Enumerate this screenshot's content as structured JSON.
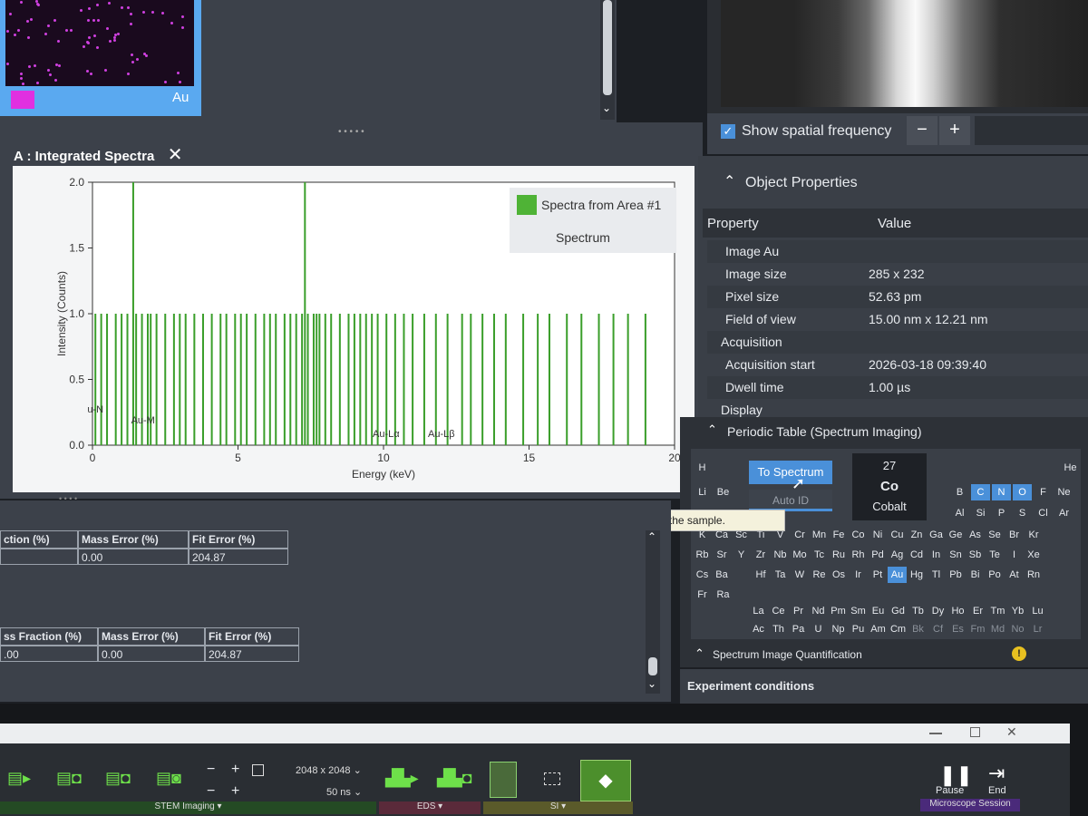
{
  "top_left_map": {
    "element_label": "Au",
    "swatch_color": "#e030e0"
  },
  "spectrum_panel": {
    "tab_title": "A : Integrated Spectra",
    "legend_series": "Spectra from Area #1",
    "legend_sub": "Spectrum",
    "xlabel": "Energy (keV)",
    "ylabel": "Intensity (Counts)",
    "line_labels": [
      "u-N",
      "Au-M",
      "Au-Lα",
      "Au-Lβ"
    ]
  },
  "chart_data": {
    "type": "bar",
    "xlabel": "Energy (keV)",
    "ylabel": "Intensity (Counts)",
    "xlim": [
      0,
      20
    ],
    "ylim": [
      0,
      2.0
    ],
    "x_ticks": [
      "0",
      "5",
      "10",
      "15",
      "20"
    ],
    "y_ticks": [
      "0.0",
      "0.5",
      "1.0",
      "1.5",
      "2.0"
    ],
    "series": [
      {
        "name": "Spectra from Area #1",
        "color": "#3a9e2a",
        "x": [
          0.1,
          0.3,
          0.5,
          0.8,
          1.0,
          1.2,
          1.5,
          1.7,
          1.9,
          2.0,
          2.2,
          2.5,
          2.8,
          3.0,
          3.2,
          3.5,
          3.8,
          4.1,
          4.4,
          4.6,
          4.9,
          5.1,
          5.3,
          5.6,
          5.9,
          6.1,
          6.3,
          6.6,
          6.8,
          7.0,
          7.2,
          7.4,
          7.6,
          7.7,
          7.8,
          8.0,
          8.2,
          8.5,
          8.8,
          9.0,
          9.2,
          9.4,
          9.6,
          9.8,
          10.1,
          10.4,
          10.7,
          11.0,
          11.4,
          11.8,
          12.2,
          12.7,
          13.0,
          13.4,
          13.8,
          14.2,
          14.8,
          15.3,
          15.7,
          16.3,
          16.8,
          17.4,
          17.9,
          18.4,
          19.0,
          1.4,
          7.3
        ],
        "values": [
          1,
          1,
          1,
          1,
          1,
          1,
          1,
          1,
          1,
          1,
          1,
          1,
          1,
          1,
          1,
          1,
          1,
          1,
          1,
          1,
          1,
          1,
          1,
          1,
          1,
          1,
          1,
          1,
          1,
          1,
          1,
          1,
          1,
          1,
          1,
          1,
          1,
          1,
          1,
          1,
          1,
          1,
          1,
          1,
          1,
          1,
          1,
          1,
          1,
          1,
          1,
          1,
          1,
          1,
          1,
          1,
          1,
          1,
          1,
          1,
          1,
          1,
          1,
          1,
          1,
          2,
          2
        ]
      }
    ]
  },
  "spatial": {
    "checkbox_label": "Show spatial frequency",
    "minus": "−",
    "plus": "+"
  },
  "object_properties": {
    "title": "Object Properties",
    "col_property": "Property",
    "col_value": "Value",
    "rows": [
      {
        "k": "Image Au",
        "v": ""
      },
      {
        "k": "Image size",
        "v": "285 x 232"
      },
      {
        "k": "Pixel size",
        "v": "52.63 pm"
      },
      {
        "k": "Field of view",
        "v": "15.00 nm x 12.21 nm"
      },
      {
        "k": "Acquisition",
        "v": ""
      },
      {
        "k": "Acquisition start",
        "v": "2026-03-18 09:39:40"
      },
      {
        "k": "Dwell time",
        "v": "1.00 µs"
      },
      {
        "k": "Display",
        "v": ""
      }
    ]
  },
  "periodic": {
    "title": "Periodic Table (Spectrum Imaging)",
    "to_spectrum": "To Spectrum",
    "auto_id": "Auto ID",
    "selected_number": "27",
    "selected_symbol": "Co",
    "selected_name": "Cobalt",
    "tooltip": "Enable Auto ID in order to automatically try to determine elements and lines in the sample."
  },
  "quant": {
    "title": "Spectrum Image Quantification",
    "experiment": "Experiment conditions"
  },
  "tables": {
    "t1_headers": [
      "ction (%)",
      "Mass Error (%)",
      "Fit Error (%)"
    ],
    "t1_values": [
      "",
      "0.00",
      "204.87"
    ],
    "t2_headers": [
      "ss Fraction (%)",
      "Mass Error (%)",
      "Fit Error (%)"
    ],
    "t2_values": [
      ".00",
      "0.00",
      "204.87"
    ]
  },
  "toolbar": {
    "resolution": "2048 x 2048",
    "dwell": "50 ns",
    "stem_label": "STEM Imaging ▾",
    "eds_label": "EDS ▾",
    "si_label": "SI ▾",
    "pause": "Pause",
    "end": "End",
    "session": "Microscope Session"
  }
}
